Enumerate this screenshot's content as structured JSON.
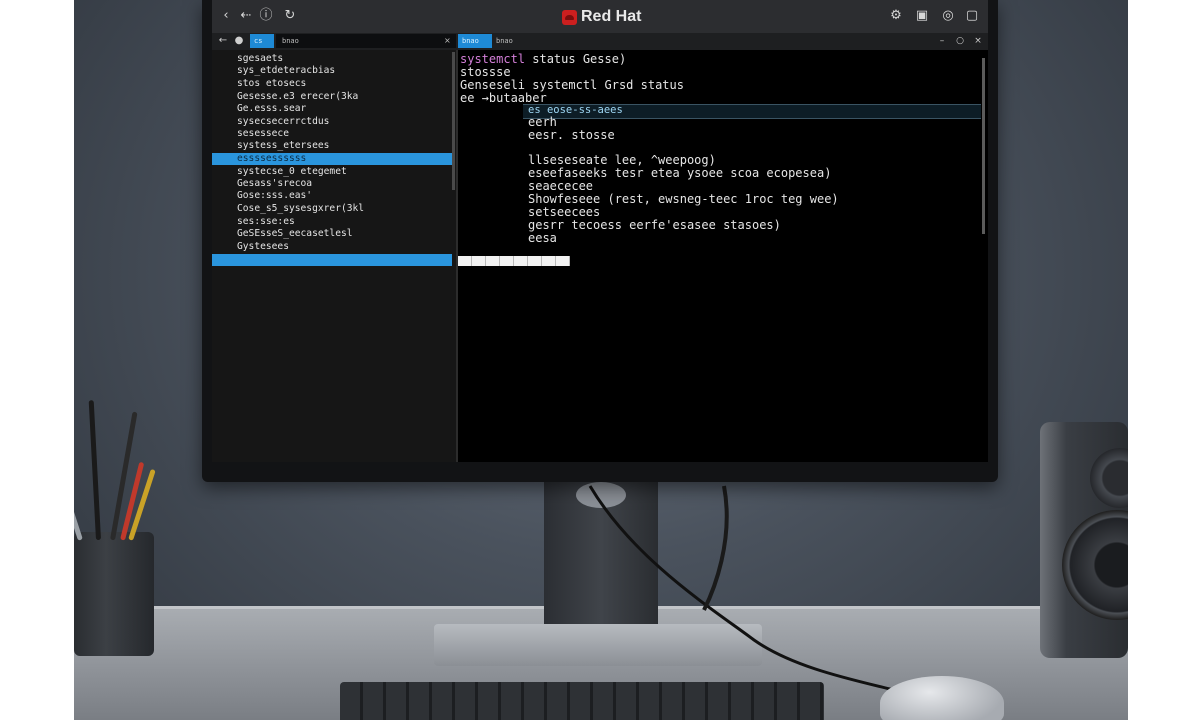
{
  "titlebar": {
    "brand": "Red Hat",
    "left_icons": [
      "chevron-left-icon",
      "arrow-left-icon",
      "info-icon",
      "refresh-icon"
    ],
    "right_icons": [
      "extensions-icon",
      "screenshot-icon",
      "settings-icon",
      "window-icon"
    ]
  },
  "addressbar": {
    "left_tab": "cs",
    "address_value": "bnao",
    "right_tab": "bnao",
    "right_tab_label": "bnao",
    "close_glyph": "×"
  },
  "left_pane": {
    "items": [
      {
        "label": "sgesaets",
        "selected": false
      },
      {
        "label": "sys_etdeteracbias",
        "selected": false
      },
      {
        "label": "stos etosecs",
        "selected": false
      },
      {
        "label": "Gesesse.e3 erecer(3ka",
        "selected": false
      },
      {
        "label": "Ge.esss.sear",
        "selected": false
      },
      {
        "label": "sysecsecerrctdus",
        "selected": false
      },
      {
        "label": "sesessece",
        "selected": false
      },
      {
        "label": "systess_etersees",
        "selected": false
      },
      {
        "label": "essssessssss",
        "selected": true
      },
      {
        "label": "systecse_0 etegemet",
        "selected": false
      },
      {
        "label": "Gesass'srecoa",
        "selected": false
      },
      {
        "label": "Gose:sss.eas'",
        "selected": false
      },
      {
        "label": "Cose_s5_sysesgxrer(3kl",
        "selected": false
      },
      {
        "label": "ses:sse:es",
        "selected": false
      },
      {
        "label": "GeSEsseS_eecasetlesl",
        "selected": false
      },
      {
        "label": "Gystesees",
        "selected": false
      },
      {
        "label": "",
        "selected": true
      }
    ]
  },
  "terminal": {
    "lines": [
      {
        "prefix": "systemctl",
        "text": " status Gesse)"
      },
      {
        "prefix": "",
        "text": "stossse"
      },
      {
        "prefix": "",
        "text": "Genseseli systemctl Grsd status"
      },
      {
        "prefix": "",
        "text": "ee →butaaber"
      },
      {
        "prefix": "",
        "text": "eerh"
      },
      {
        "prefix": "",
        "text": "eesr. stosse"
      },
      {
        "prefix": "",
        "text": "llseseseate lee, ^weepoog)"
      },
      {
        "prefix": "",
        "text": "eseefaseeks tesr etea ysoee scoa ecopesea)"
      },
      {
        "prefix": "",
        "text": "seaececee"
      },
      {
        "prefix": "",
        "text": "Showfeseee (rest, ewsneg-teec 1roc teg wee)"
      },
      {
        "prefix": "",
        "text": "setseecees"
      },
      {
        "prefix": "",
        "text": "gesrr tecoess eerfe'esasee stasoes)"
      },
      {
        "prefix": "",
        "text": "eesa"
      }
    ],
    "highlighted_line": "es  eose-ss-aees",
    "input_value": ""
  },
  "colors": {
    "selection": "#2a95dd",
    "tab_accent": "#1e8ad6",
    "brand_red": "#cc1f1f",
    "command_prefix": "#d47fd9"
  }
}
